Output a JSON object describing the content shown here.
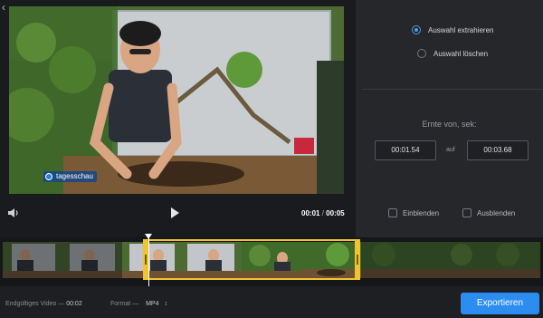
{
  "player": {
    "watermark": "tagesschau",
    "current_time": "00:01",
    "separator": "/",
    "total_time": "00:05"
  },
  "options": {
    "extract_label": "Auswahl extrahieren",
    "delete_label": "Auswahl löschen",
    "selected": "extract"
  },
  "harvest": {
    "label": "Ernte von, sek:",
    "from": "00:01.54",
    "to_word": "auf",
    "to": "00:03.68"
  },
  "fades": {
    "fade_in_label": "Einblenden",
    "fade_out_label": "Ausblenden",
    "fade_in_checked": false,
    "fade_out_checked": false
  },
  "timeline": {
    "frame_count": 9,
    "selection_start_sec": 1.54,
    "selection_end_sec": 3.68,
    "duration_sec": 5
  },
  "footer": {
    "final_video_label": "Endgültiges Video —",
    "final_video_value": "00:02",
    "format_label": "Format —",
    "format_value": "MP4",
    "export_label": "Exportieren"
  },
  "colors": {
    "accent": "#2d8cf0",
    "selection": "#f1c232",
    "background": "#1e1f22"
  },
  "icons": [
    "back-icon",
    "volume-icon",
    "play-icon",
    "sort-arrows-icon"
  ]
}
